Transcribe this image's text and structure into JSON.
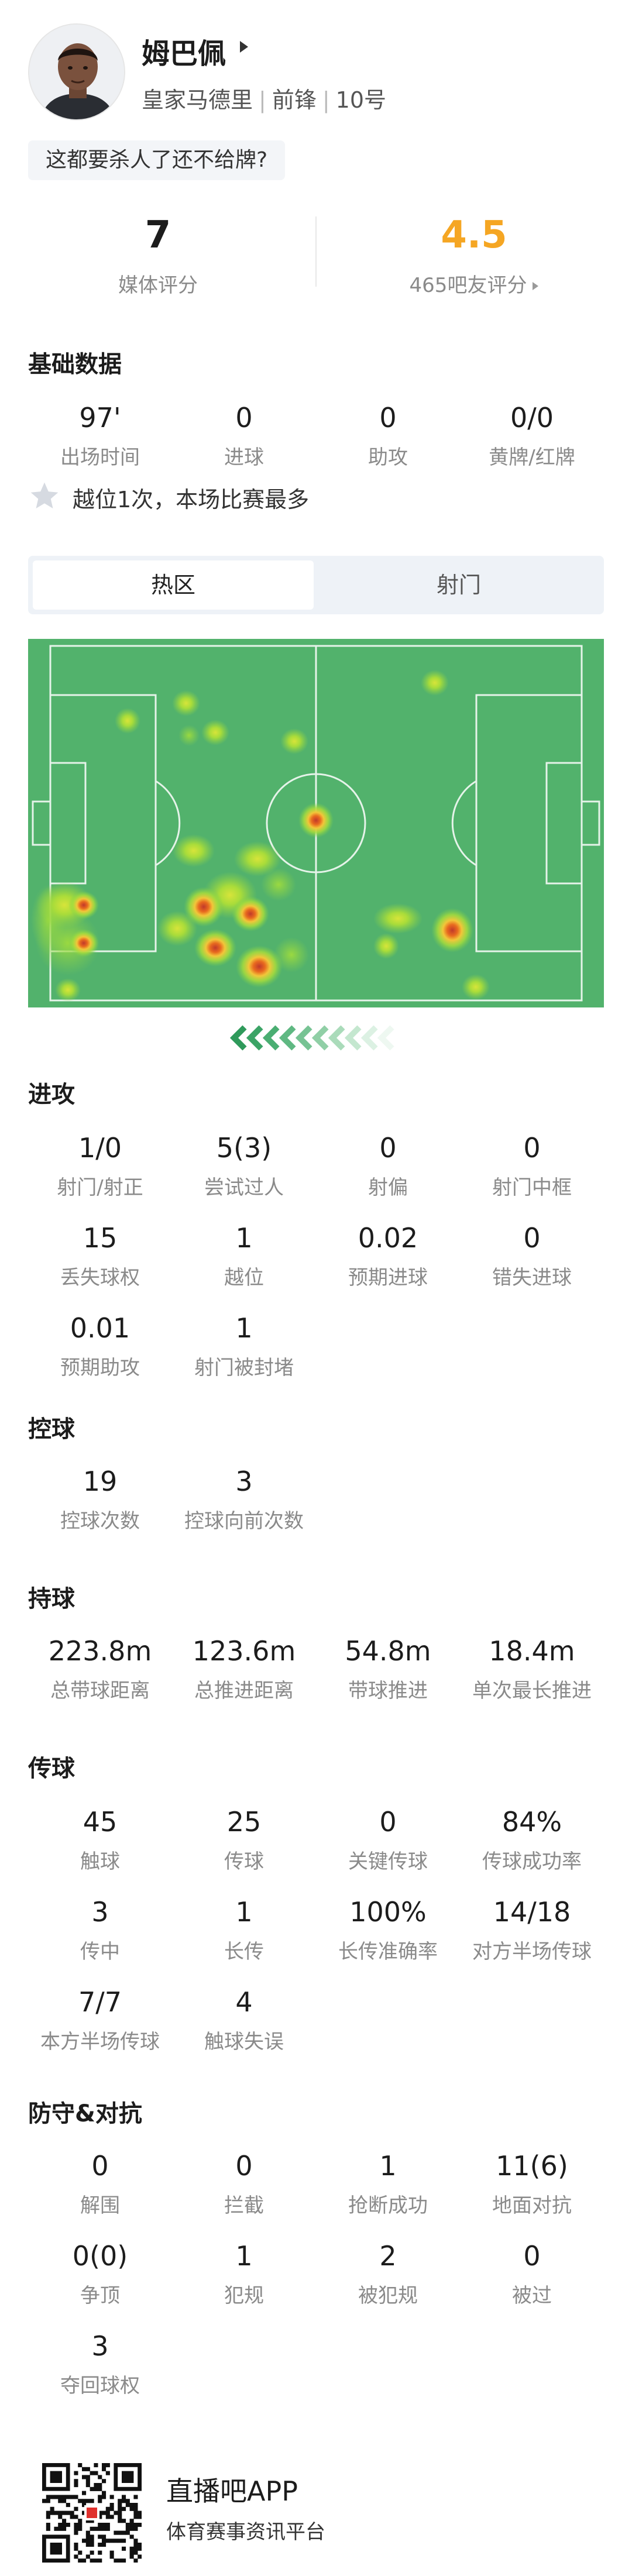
{
  "player": {
    "name": "姆巴佩",
    "team": "皇家马德里",
    "position": "前锋",
    "number": "10号",
    "comment": "这都要杀人了还不给牌?"
  },
  "ratings": {
    "media_score": "7",
    "media_label": "媒体评分",
    "fan_score": "4.5",
    "fan_label": "465吧友评分",
    "fan_color": "#f5a623"
  },
  "basic": {
    "title": "基础数据",
    "items": [
      {
        "value": "97'",
        "label": "出场时间"
      },
      {
        "value": "0",
        "label": "进球"
      },
      {
        "value": "0",
        "label": "助攻"
      },
      {
        "value": "0/0",
        "label": "黄牌/红牌"
      }
    ],
    "highlight": "越位1次，本场比赛最多",
    "highlight_icon": "star-icon"
  },
  "tabs": {
    "heatmap": "热区",
    "shots": "射门"
  },
  "pitch_colors": {
    "grass": "#52b26c",
    "line": "#ffffff"
  },
  "attack": {
    "title": "进攻",
    "items": [
      {
        "value": "1/0",
        "label": "射门/射正"
      },
      {
        "value": "5(3)",
        "label": "尝试过人"
      },
      {
        "value": "0",
        "label": "射偏"
      },
      {
        "value": "0",
        "label": "射门中框"
      },
      {
        "value": "15",
        "label": "丢失球权"
      },
      {
        "value": "1",
        "label": "越位"
      },
      {
        "value": "0.02",
        "label": "预期进球"
      },
      {
        "value": "0",
        "label": "错失进球"
      },
      {
        "value": "0.01",
        "label": "预期助攻"
      },
      {
        "value": "1",
        "label": "射门被封堵"
      }
    ]
  },
  "control": {
    "title": "控球",
    "items": [
      {
        "value": "19",
        "label": "控球次数"
      },
      {
        "value": "3",
        "label": "控球向前次数"
      }
    ]
  },
  "carry": {
    "title": "持球",
    "items": [
      {
        "value": "223.8m",
        "label": "总带球距离"
      },
      {
        "value": "123.6m",
        "label": "总推进距离"
      },
      {
        "value": "54.8m",
        "label": "带球推进"
      },
      {
        "value": "18.4m",
        "label": "单次最长推进"
      }
    ]
  },
  "passing": {
    "title": "传球",
    "items": [
      {
        "value": "45",
        "label": "触球"
      },
      {
        "value": "25",
        "label": "传球"
      },
      {
        "value": "0",
        "label": "关键传球"
      },
      {
        "value": "84%",
        "label": "传球成功率"
      },
      {
        "value": "3",
        "label": "传中"
      },
      {
        "value": "1",
        "label": "长传"
      },
      {
        "value": "100%",
        "label": "长传准确率"
      },
      {
        "value": "14/18",
        "label": "对方半场传球"
      },
      {
        "value": "7/7",
        "label": "本方半场传球"
      },
      {
        "value": "4",
        "label": "触球失误"
      }
    ]
  },
  "defense": {
    "title": "防守&对抗",
    "items": [
      {
        "value": "0",
        "label": "解围"
      },
      {
        "value": "0",
        "label": "拦截"
      },
      {
        "value": "1",
        "label": "抢断成功"
      },
      {
        "value": "11(6)",
        "label": "地面对抗"
      },
      {
        "value": "0(0)",
        "label": "争顶"
      },
      {
        "value": "1",
        "label": "犯规"
      },
      {
        "value": "2",
        "label": "被犯规"
      },
      {
        "value": "0",
        "label": "被过"
      },
      {
        "value": "3",
        "label": "夺回球权"
      }
    ]
  },
  "footer": {
    "app_name": "直播吧APP",
    "tagline": "体育赛事资讯平台"
  }
}
